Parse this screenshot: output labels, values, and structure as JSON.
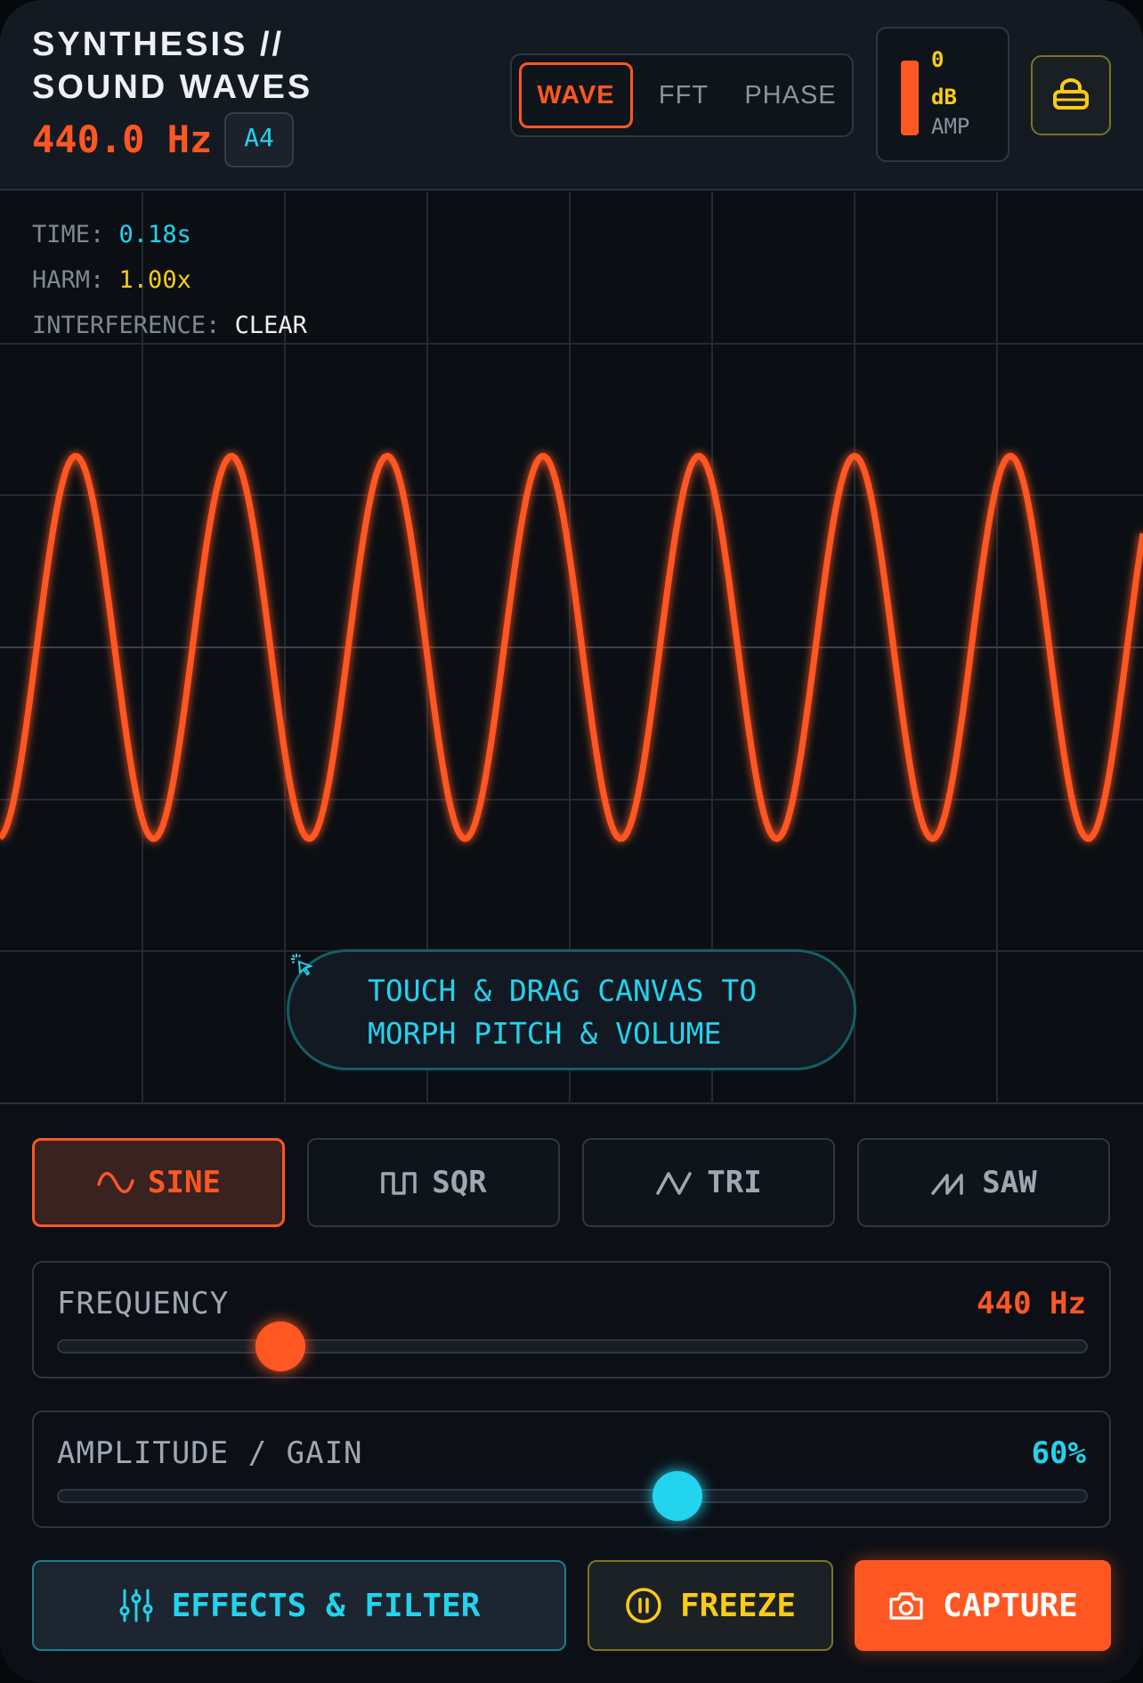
{
  "header": {
    "title": "SYNTHESIS // SOUND WAVES",
    "frequency_readout": "440.0 Hz",
    "note": "A4",
    "tabs": [
      {
        "label": "WAVE",
        "active": true
      },
      {
        "label": "FFT",
        "active": false
      },
      {
        "label": "PHASE",
        "active": false
      }
    ],
    "amp_meter": {
      "value": "0",
      "unit": "dB",
      "label": "AMP"
    },
    "lock_icon": "lock-icon"
  },
  "scope": {
    "stats": {
      "time_label": "TIME:",
      "time_value": "0.18s",
      "harm_label": "HARM:",
      "harm_value": "1.00x",
      "interference_label": "INTERFERENCE:",
      "interference_value": "CLEAR"
    },
    "hint": "TOUCH & DRAG CANVAS TO MORPH PITCH & VOLUME",
    "wave_color": "#ff5722"
  },
  "waveforms": [
    {
      "label": "SINE",
      "icon": "sine-wave-icon",
      "active": true
    },
    {
      "label": "SQR",
      "icon": "square-wave-icon",
      "active": false
    },
    {
      "label": "TRI",
      "icon": "triangle-wave-icon",
      "active": false
    },
    {
      "label": "SAW",
      "icon": "sawtooth-wave-icon",
      "active": false
    }
  ],
  "sliders": {
    "frequency": {
      "label": "FREQUENCY",
      "value": "440 Hz",
      "fraction": 0.215,
      "color": "#ff5722"
    },
    "amplitude": {
      "label": "AMPLITUDE / GAIN",
      "value": "60%",
      "fraction": 0.6,
      "color": "#22d3ee"
    }
  },
  "actions": {
    "effects": "EFFECTS & FILTER",
    "freeze": "FREEZE",
    "capture": "CAPTURE"
  }
}
